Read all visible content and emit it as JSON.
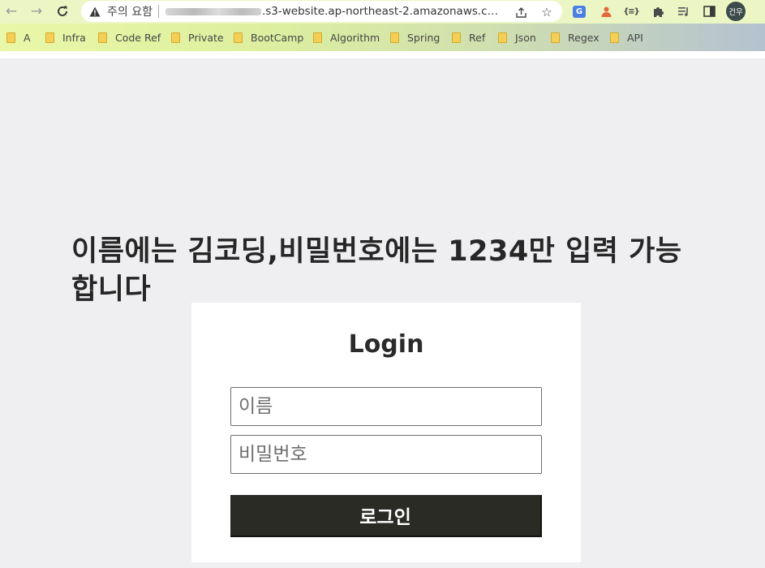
{
  "browser": {
    "security_label": "주의 요함",
    "url_visible": ".s3-website.ap-northeast-2.amazonaws.com/...",
    "profile_initials": "건우",
    "translate_badge": "G",
    "json_badge": "{≡}"
  },
  "bookmarks": [
    {
      "label": "A"
    },
    {
      "label": "Infra"
    },
    {
      "label": "Code Ref"
    },
    {
      "label": "Private"
    },
    {
      "label": "BootCamp"
    },
    {
      "label": "Algorithm"
    },
    {
      "label": "Spring"
    },
    {
      "label": "Ref"
    },
    {
      "label": "Json"
    },
    {
      "label": "Regex"
    },
    {
      "label": "API"
    }
  ],
  "page": {
    "notice": "이름에는 김코딩,비밀번호에는 1234만 입력 가능합니다",
    "login": {
      "title": "Login",
      "name_placeholder": "이름",
      "password_placeholder": "비밀번호",
      "submit_label": "로그인"
    }
  },
  "colors": {
    "page_background": "#efeef0",
    "button_background": "#2b2b26",
    "toolbar_background": "#ecf6c4"
  }
}
